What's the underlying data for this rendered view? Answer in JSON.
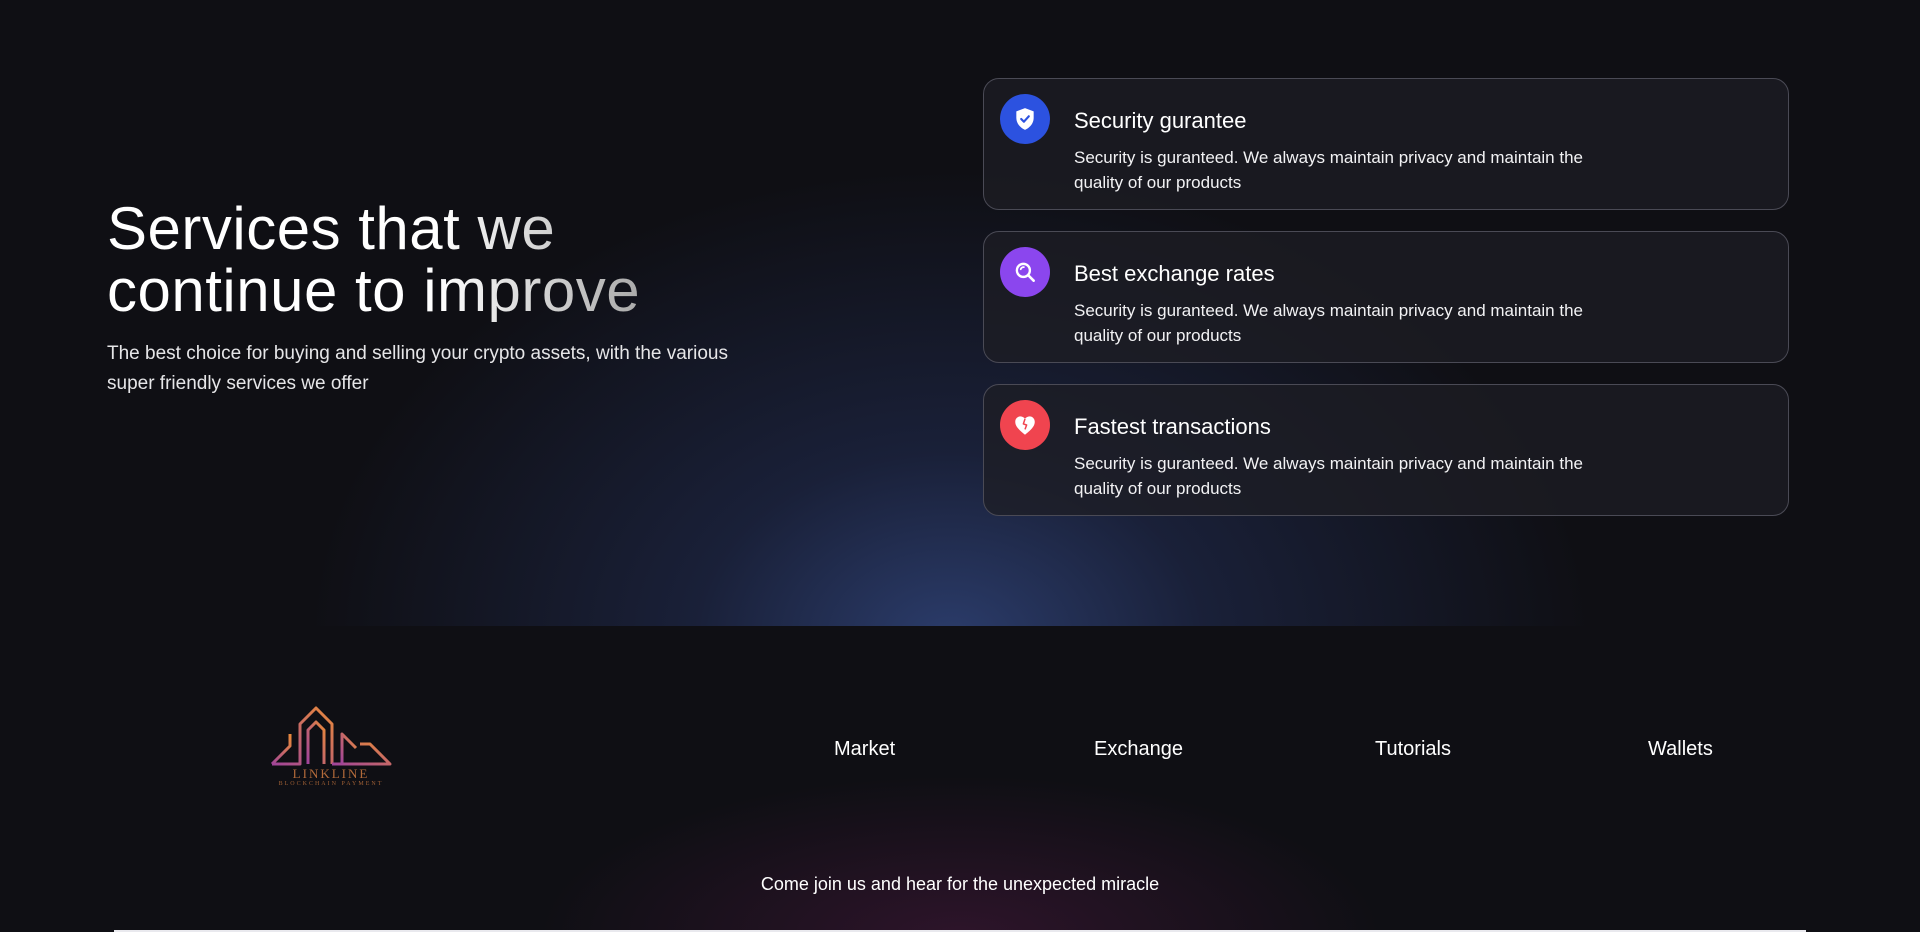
{
  "services": {
    "heading_line1": "Services that we",
    "heading_line2": "continue to improve",
    "subtitle": "The best choice for buying and selling your crypto assets, with the various super friendly services we offer",
    "cards": [
      {
        "title": "Security gurantee",
        "description": "Security is guranteed. We always maintain privacy and maintain the quality of our products",
        "icon": "shield-check-icon",
        "color": "#2c52e0"
      },
      {
        "title": "Best exchange rates",
        "description": "Security is guranteed. We always maintain privacy and maintain the quality of our products",
        "icon": "search-icon",
        "color": "#8b46ee"
      },
      {
        "title": "Fastest transactions",
        "description": "Security is guranteed. We always maintain privacy and maintain the quality of our products",
        "icon": "heart-icon",
        "color": "#f0444f"
      }
    ]
  },
  "footer": {
    "logo": {
      "name": "LINKLINE",
      "tagline": "BLOCKCHAIN PAYMENT"
    },
    "nav": [
      "Market",
      "Exchange",
      "Tutorials",
      "Wallets"
    ],
    "tagline": "Come join us and hear for the unexpected miracle"
  },
  "colors": {
    "background": "#0f0f14",
    "card_border": "#4a4a55",
    "logo_gradient_start": "#a0449a",
    "logo_gradient_end": "#e8893a"
  }
}
